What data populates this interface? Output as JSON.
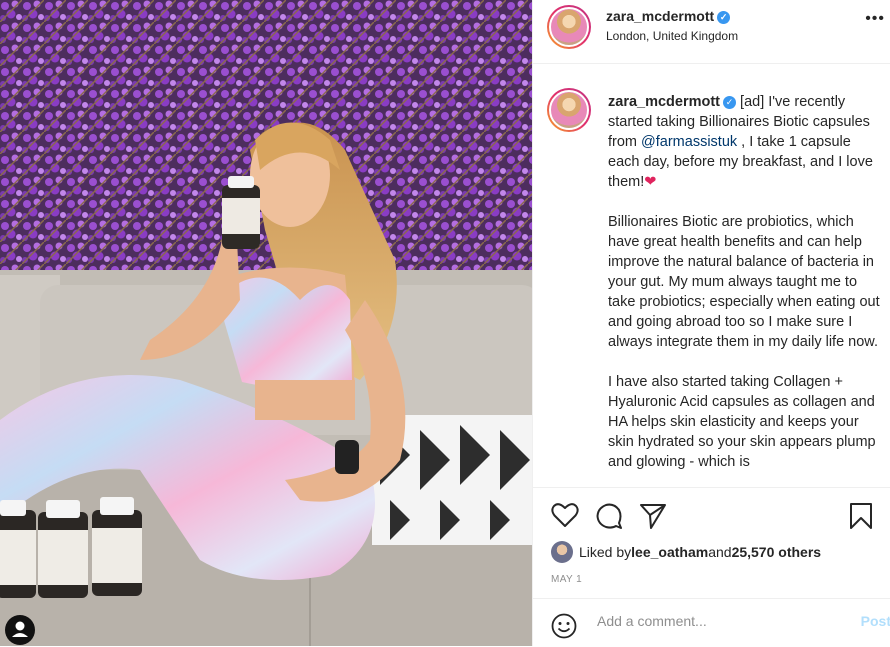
{
  "post": {
    "username": "zara_mcdermott",
    "location": "London, United Kingdom",
    "caption": {
      "p1_prefix": " [ad] I've recently started taking Billionaires Biotic capsules from ",
      "p1_mention": "@farmassistuk",
      "p1_suffix": " , I take 1 capsule each day, before my breakfast, and I love them!",
      "p1_emoji": "❤",
      "p2": "Billionaires Biotic are probiotics, which have great health benefits and can help improve the natural balance of bacteria in your gut. My mum always taught me to take probiotics; especially when eating out and going abroad too so I make sure I always integrate them in my daily life now.",
      "p3": "I have also started taking Collagen + Hyaluronic Acid capsules as collagen and HA helps skin elasticity and keeps your skin hydrated so your skin appears plump and glowing - which is"
    },
    "likes": {
      "prefix": "Liked by ",
      "user": "lee_oatham",
      "and": " and ",
      "count": "25,570 others"
    },
    "date": "MAY 1",
    "comment_placeholder": "Add a comment...",
    "post_label": "Post",
    "more_label": "•••"
  },
  "icons": [
    "heart-icon",
    "comment-icon",
    "share-icon",
    "bookmark-icon",
    "emoji-icon",
    "user-tag-icon"
  ],
  "colors": {
    "accent": "#0095f6",
    "verified": "#3897f0",
    "mention": "#00376b",
    "post_disabled": "#b2dffc"
  }
}
